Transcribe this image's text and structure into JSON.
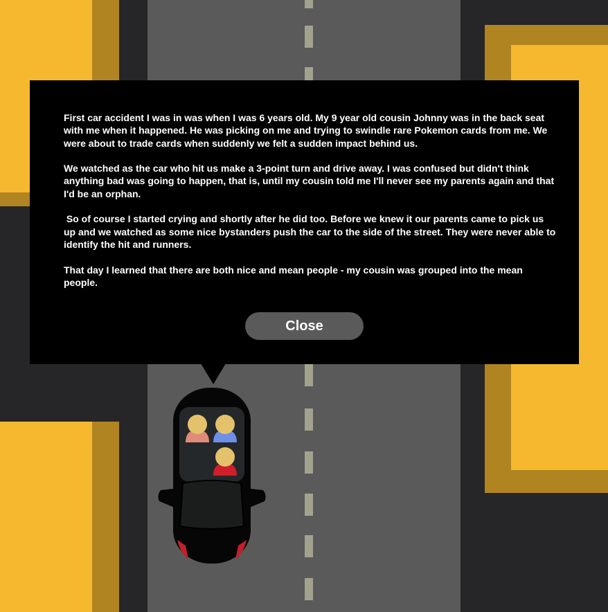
{
  "dialog": {
    "paragraphs": [
      "First car accident I was in was when I was 6 years old. My 9 year old cousin Johnny was in the back seat with me when it happened. He was picking on me and trying to swindle rare Pokemon cards from me. We were about to trade cards when suddenly we felt a sudden impact behind us.",
      "We watched as the car who hit us make a 3-point turn and drive away. I was confused but didn't think anything bad was going to happen, that is, until my cousin told me I'll never see my parents again and that I'd be an orphan.",
      " So of course I started crying and shortly after he did too. Before we knew it our parents came to pick us up and we watched as some nice bystanders push the car to the side of the street. They were never able to identify the hit and runners.",
      "That day I learned that there are both nice and mean people - my cousin was grouped into the mean people."
    ],
    "close_label": "Close"
  },
  "colors": {
    "background": "#262527",
    "road": "#5a5a5b",
    "lane_marking": "#a3a28f",
    "building": "#f5b82e",
    "building_shadow": "#b08420",
    "dialog": "#000000",
    "button": "#5a5a5b",
    "car_body": "#060606",
    "passenger_left_shirt": "#e08b78",
    "passenger_right_shirt": "#6f8fe6",
    "passenger_back_shirt": "#d01f2a",
    "passenger_head": "#e3c26b"
  },
  "icons": {
    "car": "car-icon",
    "passengers": [
      "passenger-left-icon",
      "passenger-right-icon",
      "passenger-back-icon"
    ]
  }
}
